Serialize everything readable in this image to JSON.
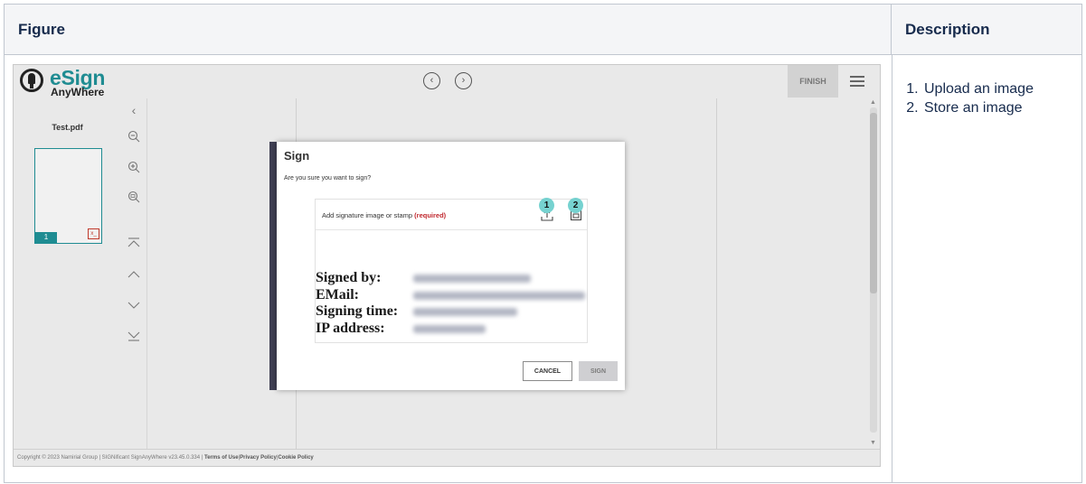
{
  "table": {
    "figure_header": "Figure",
    "description_header": "Description",
    "description_items": [
      "Upload an image",
      "Store an image"
    ]
  },
  "app": {
    "logo_name": "eSign",
    "logo_sub": "AnyWhere",
    "finish_label": "FINISH",
    "document_name": "Test.pdf",
    "page_number": "1",
    "footer": {
      "copyright": "Copyright © 2023 Namirial Group | SIGNificant SignAnyWhere v23.45.0.334 |",
      "terms": "Terms of Use",
      "privacy": "Privacy Policy",
      "cookie": "Cookie Policy"
    },
    "accent_color": "#1f8c92"
  },
  "dialog": {
    "title": "Sign",
    "question": "Are you sure you want to sign?",
    "signature_label": "Add signature image or stamp",
    "required_label": "(required)",
    "badges": [
      "1",
      "2"
    ],
    "stamp_fields": [
      "Signed by:",
      "EMail:",
      "Signing time:",
      "IP address:"
    ],
    "cancel_label": "CANCEL",
    "sign_label": "SIGN"
  }
}
